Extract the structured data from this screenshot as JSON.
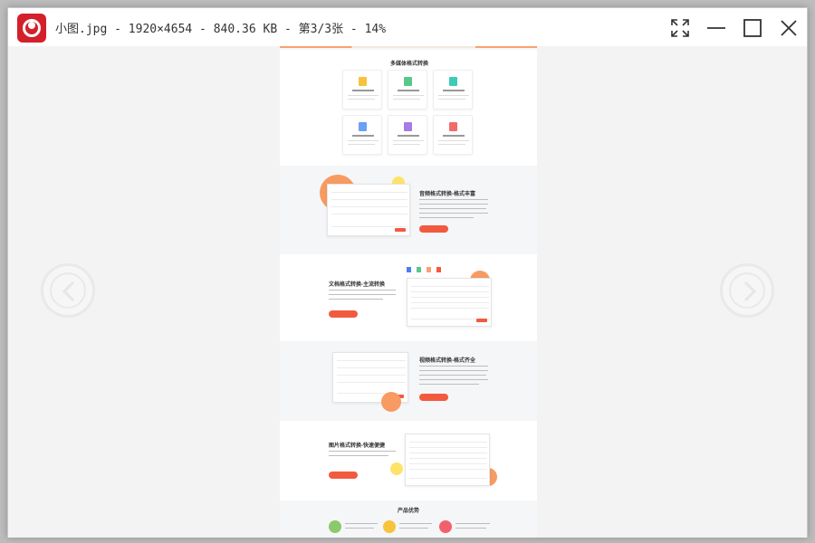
{
  "window": {
    "title": "小图.jpg - 1920×4654 - 840.36 KB - 第3/3张 - 14%"
  },
  "controls": {
    "fullscreen_icon": "fullscreen-icon",
    "minimize_icon": "minimize-icon",
    "maximize_icon": "maximize-icon",
    "close_icon": "close-icon",
    "prev_icon": "chevron-left-icon",
    "next_icon": "chevron-right-icon"
  },
  "image": {
    "section_title": "多媒体格式转换",
    "audio": {
      "title": "音频格式转换-格式丰富"
    },
    "document": {
      "title": "文档格式转换-主流转换"
    },
    "video": {
      "title": "视频格式转换-格式齐全"
    },
    "picture": {
      "title": "图片格式转换-快速便捷"
    },
    "advantages_title": "产品优势"
  },
  "colors": {
    "accent": "#f25a3f",
    "orange": "#f7a26e",
    "yellow": "#fde36a"
  }
}
